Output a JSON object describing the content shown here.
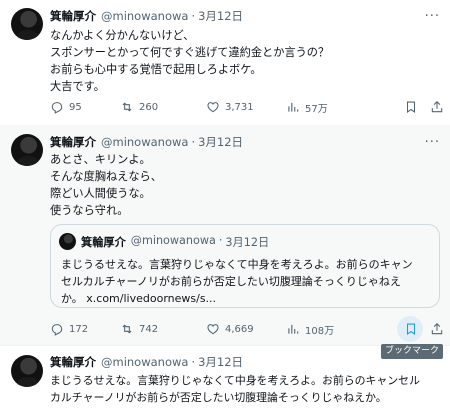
{
  "tweets": [
    {
      "name": "箕輪厚介",
      "handle": "@minowanowa",
      "separator": "·",
      "date": "3月12日",
      "more": "···",
      "lines": [
        "なんかよく分かんないけど、",
        "スポンサーとかって何ですぐ逃げて違約金とか言うの？",
        "お前らも心中する覚悟で起用しろよボケ。",
        "大吉です。"
      ],
      "replies": "95",
      "retweets": "260",
      "likes": "3,731",
      "views": "57万"
    },
    {
      "name": "箕輪厚介",
      "handle": "@minowanowa",
      "separator": "·",
      "date": "3月12日",
      "more": "···",
      "lines": [
        "あとさ、キリンよ。",
        "そんな度胸ねえなら、",
        "際どい人間使うな。",
        "使うなら守れ。"
      ],
      "quote": {
        "name": "箕輪厚介",
        "handle": "@minowanowa",
        "separator": "·",
        "date": "3月12日",
        "lines": [
          "まじうるせえな。言葉狩りじゃなくて中身を考えろよ。お前らのキャン",
          "セルカルチャーノリがお前らが否定したい切腹理論そっくりじゃねえ",
          "か。 x.com/livedoornews/s..."
        ]
      },
      "replies": "172",
      "retweets": "742",
      "likes": "4,669",
      "views": "108万"
    },
    {
      "name": "箕輪厚介",
      "handle": "@minowanowa",
      "separator": "·",
      "date": "3月12日",
      "more": "···",
      "lines": [
        "まじうるせえな。言葉狩りじゃなくて中身を考えろよ。お前らのキャンセル",
        "カルチャーノリがお前らが否定したい切腹理論そっくりじゃねえか。"
      ]
    }
  ],
  "tooltip": "ブックマーク",
  "colors": {
    "text": "#0f1419",
    "secondary": "#536471",
    "border": "#cfd9de",
    "hover_bg": "#f7f9f9",
    "tooltip_bg": "#5c6a74"
  }
}
